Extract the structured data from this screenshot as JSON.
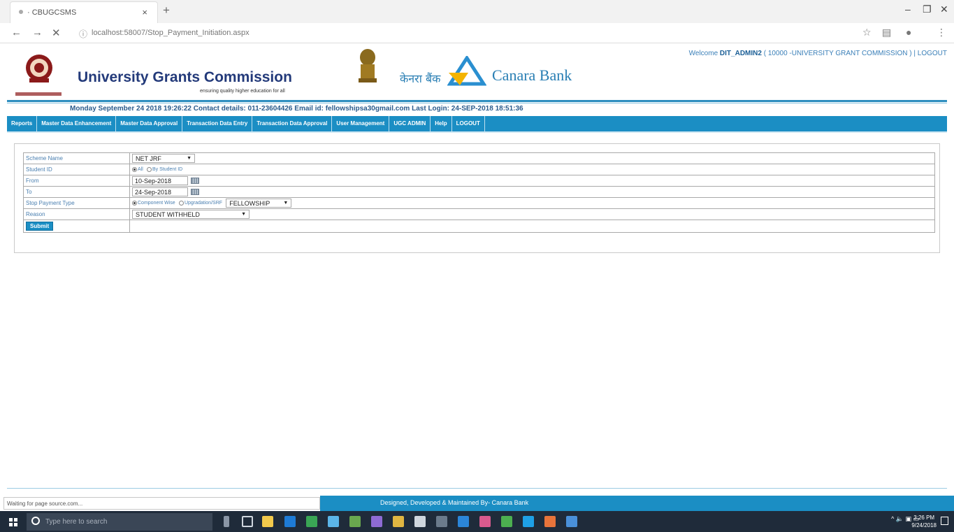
{
  "browser": {
    "tab_title": "· CBUGCSMS",
    "tab_close": "×",
    "new_tab": "+",
    "url": "localhost:58007/Stop_Payment_Initiation.aspx",
    "status_text": "Waiting for page source.com..."
  },
  "header": {
    "org_title": "University Grants Commission",
    "tagline": "ensuring quality higher education for all",
    "bank_hindi": "केनरा बैंक",
    "bank_name": "Canara Bank",
    "welcome_prefix": "Welcome ",
    "welcome_user": "DIT_ADMIN2",
    "welcome_org": " ( 10000 -UNIVERSITY GRANT COMMISSION ) | ",
    "logout": "LOGOUT"
  },
  "infoline": "Monday September 24 2018 19:26:22   Contact details: 011-23604426   Email id: fellowshipsa30gmail.com   Last Login: 24-SEP-2018 18:51:36",
  "menu": [
    "Reports",
    "Master Data Enhancement",
    "Master Data Approval",
    "Transaction Data Entry",
    "Transaction Data Approval",
    "User Management",
    "UGC ADMIN",
    "Help",
    "LOGOUT"
  ],
  "form": {
    "scheme_label": "Scheme Name",
    "scheme_value": "NET JRF",
    "student_label": "Student ID",
    "student_opt_all": "All",
    "student_opt_by": "By Student ID",
    "from_label": "From",
    "from_value": "10-Sep-2018",
    "to_label": "To",
    "to_value": "24-Sep-2018",
    "stop_label": "Stop Payment Type",
    "stop_opt_component": "Component Wise",
    "stop_opt_upgrade": "Upgradation/SRF",
    "stop_component_value": "FELLOWSHIP",
    "reason_label": "Reason",
    "reason_value": "STUDENT WITHHELD",
    "submit_label": "Submit"
  },
  "footer_text": "Designed, Developed & Maintained By- Canara Bank",
  "taskbar": {
    "search_placeholder": "Type here to search",
    "time": "3:26 PM",
    "date": "9/24/2018"
  },
  "colors": {
    "menu_bg": "#1b8ec4",
    "title_color": "#233a7a",
    "bank_color": "#2a7fb4"
  }
}
